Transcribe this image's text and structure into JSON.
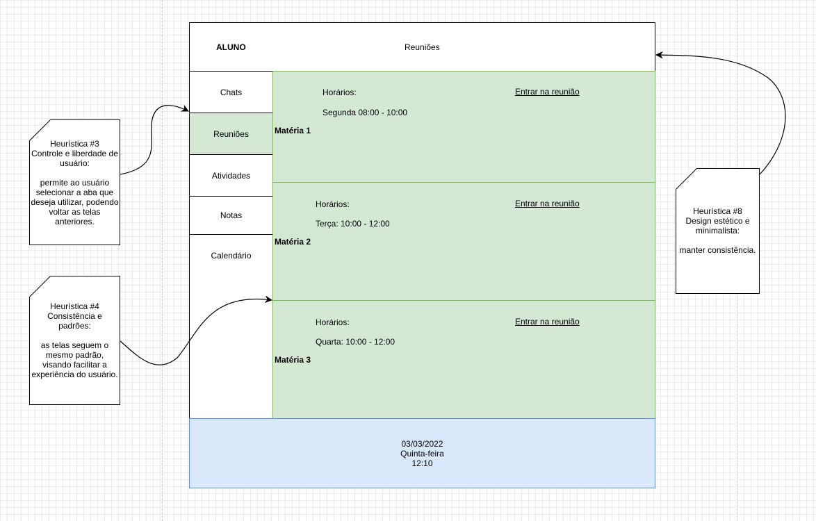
{
  "header": {
    "student_label": "ALUNO",
    "page_title": "Reuniões"
  },
  "nav": {
    "items": [
      {
        "label": "Chats",
        "active": false
      },
      {
        "label": "Reuniões",
        "active": true
      },
      {
        "label": "Atividades",
        "active": false
      },
      {
        "label": "Notas",
        "active": false
      },
      {
        "label": "Calendário",
        "active": false
      }
    ]
  },
  "subjects": [
    {
      "name": "Matéria 1",
      "schedule_label": "Horários:",
      "schedule": "Segunda 08:00 - 10:00",
      "join_label": "Entrar na reunião"
    },
    {
      "name": "Matéria 2",
      "schedule_label": "Horários:",
      "schedule": "Terça: 10:00 - 12:00",
      "join_label": "Entrar na reunião"
    },
    {
      "name": "Matéria 3",
      "schedule_label": "Horários:",
      "schedule": "Quarta: 10:00 - 12:00",
      "join_label": "Entrar na reunião"
    }
  ],
  "footer": {
    "date": "03/03/2022",
    "weekday": "Quinta-feira",
    "time": "12:10"
  },
  "annotations": [
    {
      "lines": [
        "Heurística #3",
        "Controle e liberdade de",
        "usuário:",
        "",
        "permite ao usuário",
        "selecionar a aba que",
        "deseja utilizar, podendo",
        "voltar as telas",
        "anteriores."
      ]
    },
    {
      "lines": [
        "Heurística #4",
        "Consistência e",
        "padrões:",
        "",
        "as telas seguem o",
        "mesmo padrão,",
        "visando facilitar a",
        "experiência do usuário."
      ]
    },
    {
      "lines": [
        "Heurística #8",
        "Design estético e",
        "minimalista:",
        "",
        "manter consistência."
      ]
    }
  ],
  "colors": {
    "active_green": "#d5e8d4",
    "green_border": "#82b366",
    "footer_blue": "#dae8fc",
    "blue_border": "#6c8ebf"
  }
}
